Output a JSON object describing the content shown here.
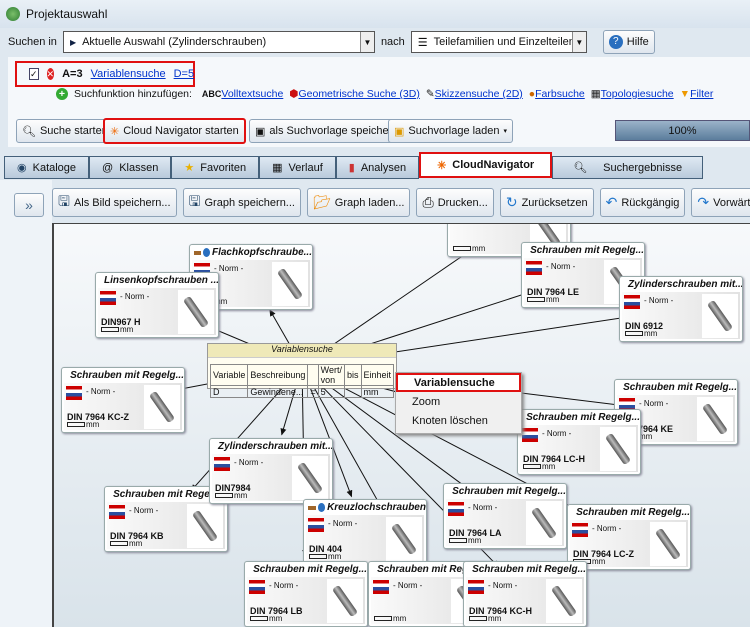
{
  "window": {
    "title": "Projektauswahl"
  },
  "search": {
    "in_label": "Suchen in",
    "scope": "Aktuelle Auswahl (Zylinderschrauben)",
    "nach_label": "nach",
    "target": "Teilefamilien und Einzelteilen",
    "help": "Hilfe"
  },
  "criteria": {
    "checked": true,
    "var": "A=3",
    "link": "Variablensuche",
    "value": "D=5"
  },
  "add": {
    "label": "Suchfunktion hinzufügen:",
    "abc": "ABC",
    "items": [
      "Volltextsuche",
      "Geometrische Suche (3D)",
      "Skizzensuche (2D)",
      "Farbsuche",
      "Topologiesuche",
      "Filter"
    ]
  },
  "actions": {
    "start": "Suche starten",
    "cloud": "Cloud Navigator starten",
    "save_tpl": "als Suchvorlage speichern",
    "load_tpl": "Suchvorlage laden",
    "progress_label": "100%",
    "progress": 100
  },
  "tabs": [
    "Kataloge",
    "Klassen",
    "Favoriten",
    "Verlauf",
    "Analysen",
    "CloudNavigator",
    "Suchergebnisse"
  ],
  "toolbar": {
    "collapse": "»",
    "items": [
      "Als Bild speichern...",
      "Graph speichern...",
      "Graph laden...",
      "Drucken...",
      "Zurücksetzen",
      "Rückgängig",
      "Vorwärts"
    ]
  },
  "varsearch": {
    "title": "Variablensuche",
    "headers": [
      "Variable",
      "Beschreibung",
      "",
      "Wert/ von",
      "bis",
      "Einheit"
    ],
    "row": [
      "D",
      "Gewindene...",
      "=",
      "5",
      "",
      "mm"
    ]
  },
  "context_menu": [
    "Variablensuche",
    "Zoom",
    "Knoten löschen"
  ],
  "node_common": {
    "norm": "- Norm -",
    "unit": "mm"
  },
  "nodes": [
    {
      "title": "",
      "code": ""
    },
    {
      "title": "Flachkopfschraube...",
      "code": ""
    },
    {
      "title": "Linsenkopfschrauben ...",
      "code": "DIN967 H"
    },
    {
      "title": "Schrauben mit Regelg...",
      "code": "DIN 7964 KC-Z"
    },
    {
      "title": "Schrauben mit Regelg...",
      "code": "DIN 7964 LE"
    },
    {
      "title": "Zylinderschrauben mit...",
      "code": "DIN 6912"
    },
    {
      "title": "Schrauben mit Regelg...",
      "code": "DIN 7964 KE"
    },
    {
      "title": "Schrauben mit Regelg...",
      "code": "DIN 7964 LC-H"
    },
    {
      "title": "Zylinderschrauben mit...",
      "code": "DIN7984"
    },
    {
      "title": "Schrauben mit Regelg...",
      "code": "DIN 7964 KB"
    },
    {
      "title": "Kreuzlochschrauben",
      "code": "DIN 404"
    },
    {
      "title": "Schrauben mit Regelg...",
      "code": "DIN 7964 LA"
    },
    {
      "title": "Schrauben mit Regelg...",
      "code": "DIN 7964 LC-Z"
    },
    {
      "title": "Schrauben mit Regelg...",
      "code": "DIN 7964 LB"
    },
    {
      "title": "Schrauben mit Regelg...",
      "code": ""
    },
    {
      "title": "Schrauben mit Regelg...",
      "code": "DIN 7964 KC-H"
    }
  ]
}
